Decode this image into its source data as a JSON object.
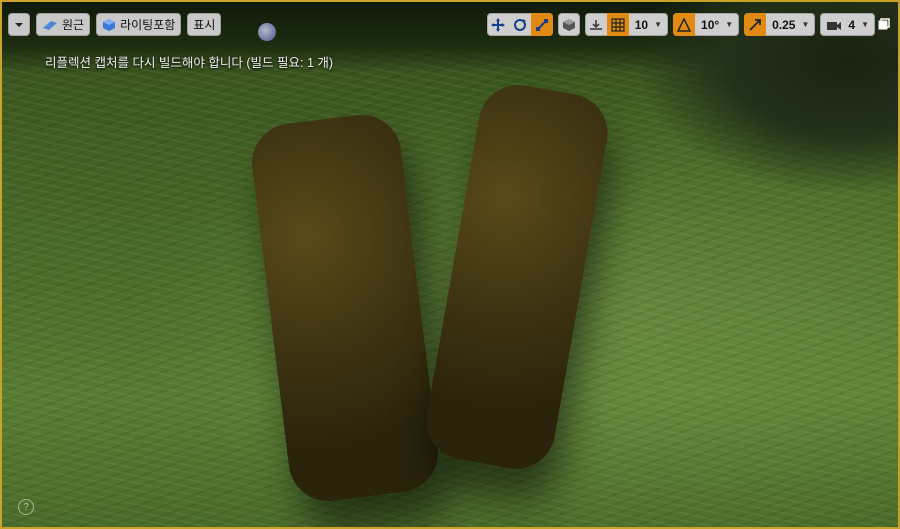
{
  "toolbar_left": {
    "perspective_label": "원근",
    "lighting_label": "라이팅포함",
    "show_label": "표시"
  },
  "toolbar_right": {
    "grid_snap_value": "10",
    "rotation_snap_value": "10°",
    "scale_snap_value": "0.25",
    "camera_speed_value": "4"
  },
  "viewport": {
    "message": "리플렉션 캡처를 다시 빌드해야 합니다 (빌드 필요: 1 개)"
  },
  "colors": {
    "accent": "#e08a14",
    "border": "#c9a227"
  }
}
